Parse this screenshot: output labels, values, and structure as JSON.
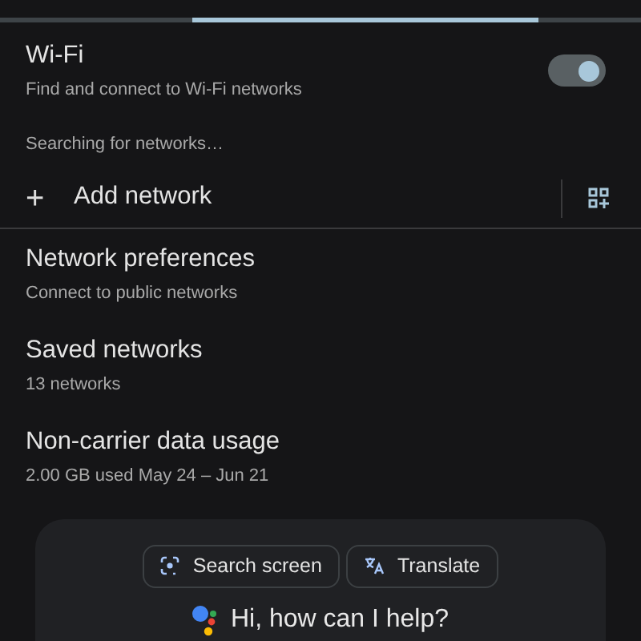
{
  "wifi": {
    "title": "Wi-Fi",
    "subtitle": "Find and connect to Wi-Fi networks",
    "on": true
  },
  "status": "Searching for networks…",
  "add_network": {
    "icon": "+",
    "label": "Add network"
  },
  "items": [
    {
      "title": "Network preferences",
      "subtitle": "Connect to public networks"
    },
    {
      "title": "Saved networks",
      "subtitle": "13 networks"
    },
    {
      "title": "Non-carrier data usage",
      "subtitle": "2.00 GB used May 24 – Jun 21"
    }
  ],
  "assistant": {
    "chips": [
      {
        "kind": "lens",
        "label": "Search screen"
      },
      {
        "kind": "translate",
        "label": "Translate"
      }
    ],
    "greeting": "Hi, how can I help?"
  }
}
